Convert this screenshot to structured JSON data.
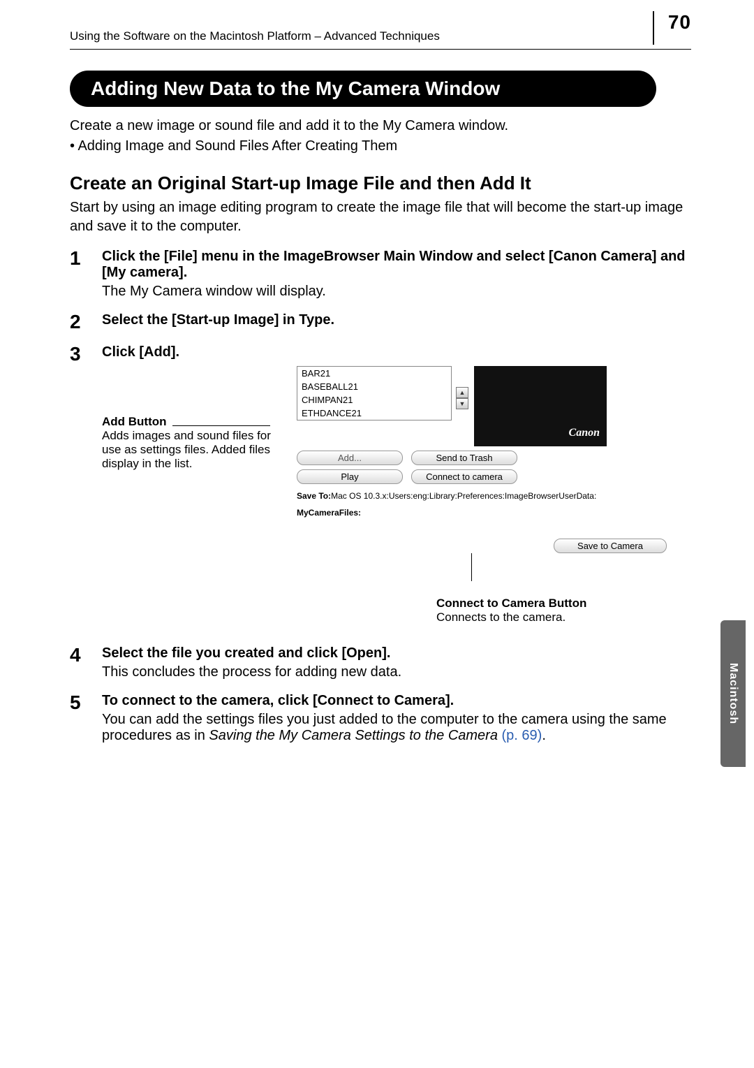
{
  "header": {
    "breadcrumb": "Using the Software on the Macintosh Platform – Advanced Techniques",
    "page_number": "70"
  },
  "banner": {
    "title": "Adding New Data to the My Camera Window"
  },
  "intro": {
    "line1": "Create a new image or sound file and add it to the My Camera window.",
    "bullet": "• Adding Image and Sound Files After Creating Them"
  },
  "subhead": "Create an Original Start-up Image File and then Add It",
  "subtext": "Start by using an image editing program to create the image file that will become the start-up image and save it to the computer.",
  "steps": {
    "s1_bold": "Click the [File] menu in the ImageBrowser Main Window and select [Canon Camera] and [My camera].",
    "s1_plain": "The My Camera window will display.",
    "s2_bold": "Select the [Start-up Image] in Type.",
    "s3_bold": "Click [Add].",
    "s4_bold": "Select the file you created and click [Open].",
    "s4_plain": "This concludes the process for adding new data.",
    "s5_bold": "To connect to the camera, click [Connect to Camera].",
    "s5_plain_a": "You can add the settings files you just added to the computer to the camera using the same procedures as in ",
    "s5_italic": "Saving the My Camera Settings to the Camera",
    "s5_link": " (p. 69)",
    "s5_end": "."
  },
  "callouts": {
    "add_title": "Add Button",
    "add_body": "Adds images and sound files for use as settings files. Added files display in the list.",
    "conn_title": "Connect to Camera Button",
    "conn_body": "Connects to the camera."
  },
  "ui": {
    "list": [
      "BAR21",
      "BASEBALL21",
      "CHIMPAN21",
      "ETHDANCE21"
    ],
    "btn_add": "Add...",
    "btn_trash": "Send to Trash",
    "btn_play": "Play",
    "btn_connect": "Connect to camera",
    "preview_logo": "Canon",
    "save_to_label": "Save To:",
    "save_to_path": "Mac OS 10.3.x:Users:eng:Library:Preferences:ImageBrowserUserData:",
    "mycam_label": "MyCameraFiles:",
    "btn_save_cam": "Save to Camera"
  },
  "sidebar_tab": "Macintosh"
}
